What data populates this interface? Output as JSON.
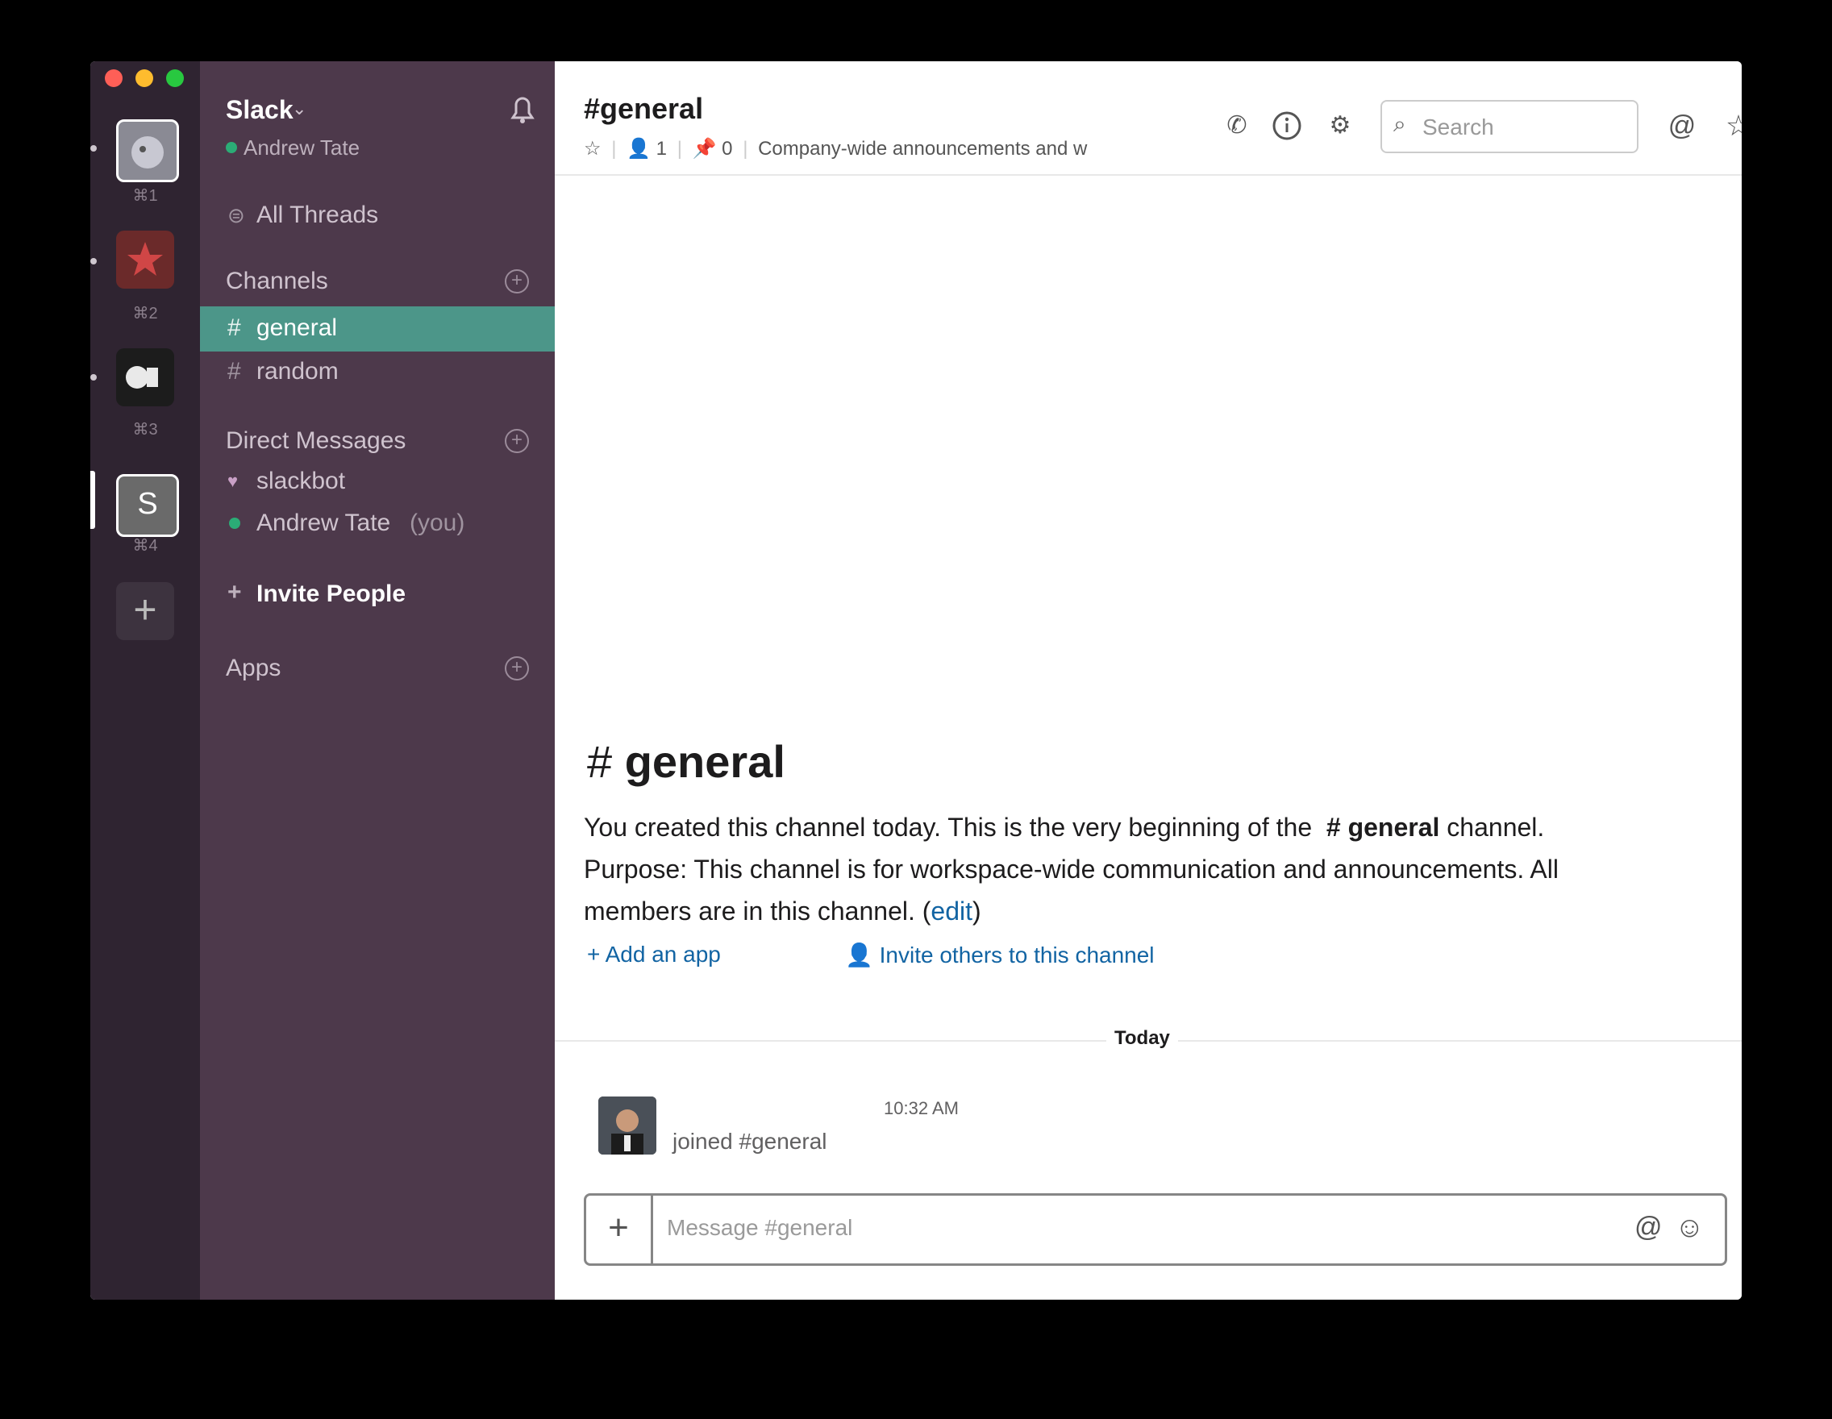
{
  "workspace_switcher": {
    "shortcuts": [
      "⌘1",
      "⌘2",
      "⌘3",
      "⌘4"
    ],
    "workspace_4_initial": "S",
    "add_label": "+"
  },
  "sidebar": {
    "workspace_name": "Slack",
    "user_name": "Andrew Tate",
    "all_threads": "All Threads",
    "channels_header": "Channels",
    "channels": [
      {
        "name": "general",
        "active": true
      },
      {
        "name": "random",
        "active": false
      }
    ],
    "dm_header": "Direct Messages",
    "dms": [
      "slackbot",
      "Andrew Tate"
    ],
    "you_suffix": "(you)",
    "invite_people": "Invite People",
    "apps_header": "Apps"
  },
  "header": {
    "channel_title": "#general",
    "members_count": "1",
    "pins_count": "0",
    "topic": "Company-wide announcements and w",
    "search_placeholder": "Search"
  },
  "intro": {
    "title": "general",
    "line1_prefix": "You created this channel today. This is the very beginning of the",
    "line1_channel": "general",
    "line1_suffix": "channel.",
    "line2": "Purpose: This channel is for workspace-wide communication and announcements. All",
    "line3_prefix": "members are in this channel.",
    "edit_link": "edit",
    "add_app": "Add an app",
    "invite_others": "Invite others to this channel"
  },
  "messages": {
    "day_divider": "Today",
    "items": [
      {
        "time": "10:32 AM",
        "text": "joined #general"
      }
    ]
  },
  "composer": {
    "placeholder": "Message #general",
    "plus": "+"
  },
  "colors": {
    "sidebar_bg": "#4d394b",
    "workspace_bg": "#2f2431",
    "active_channel": "#4c9689",
    "link": "#1264a3"
  }
}
